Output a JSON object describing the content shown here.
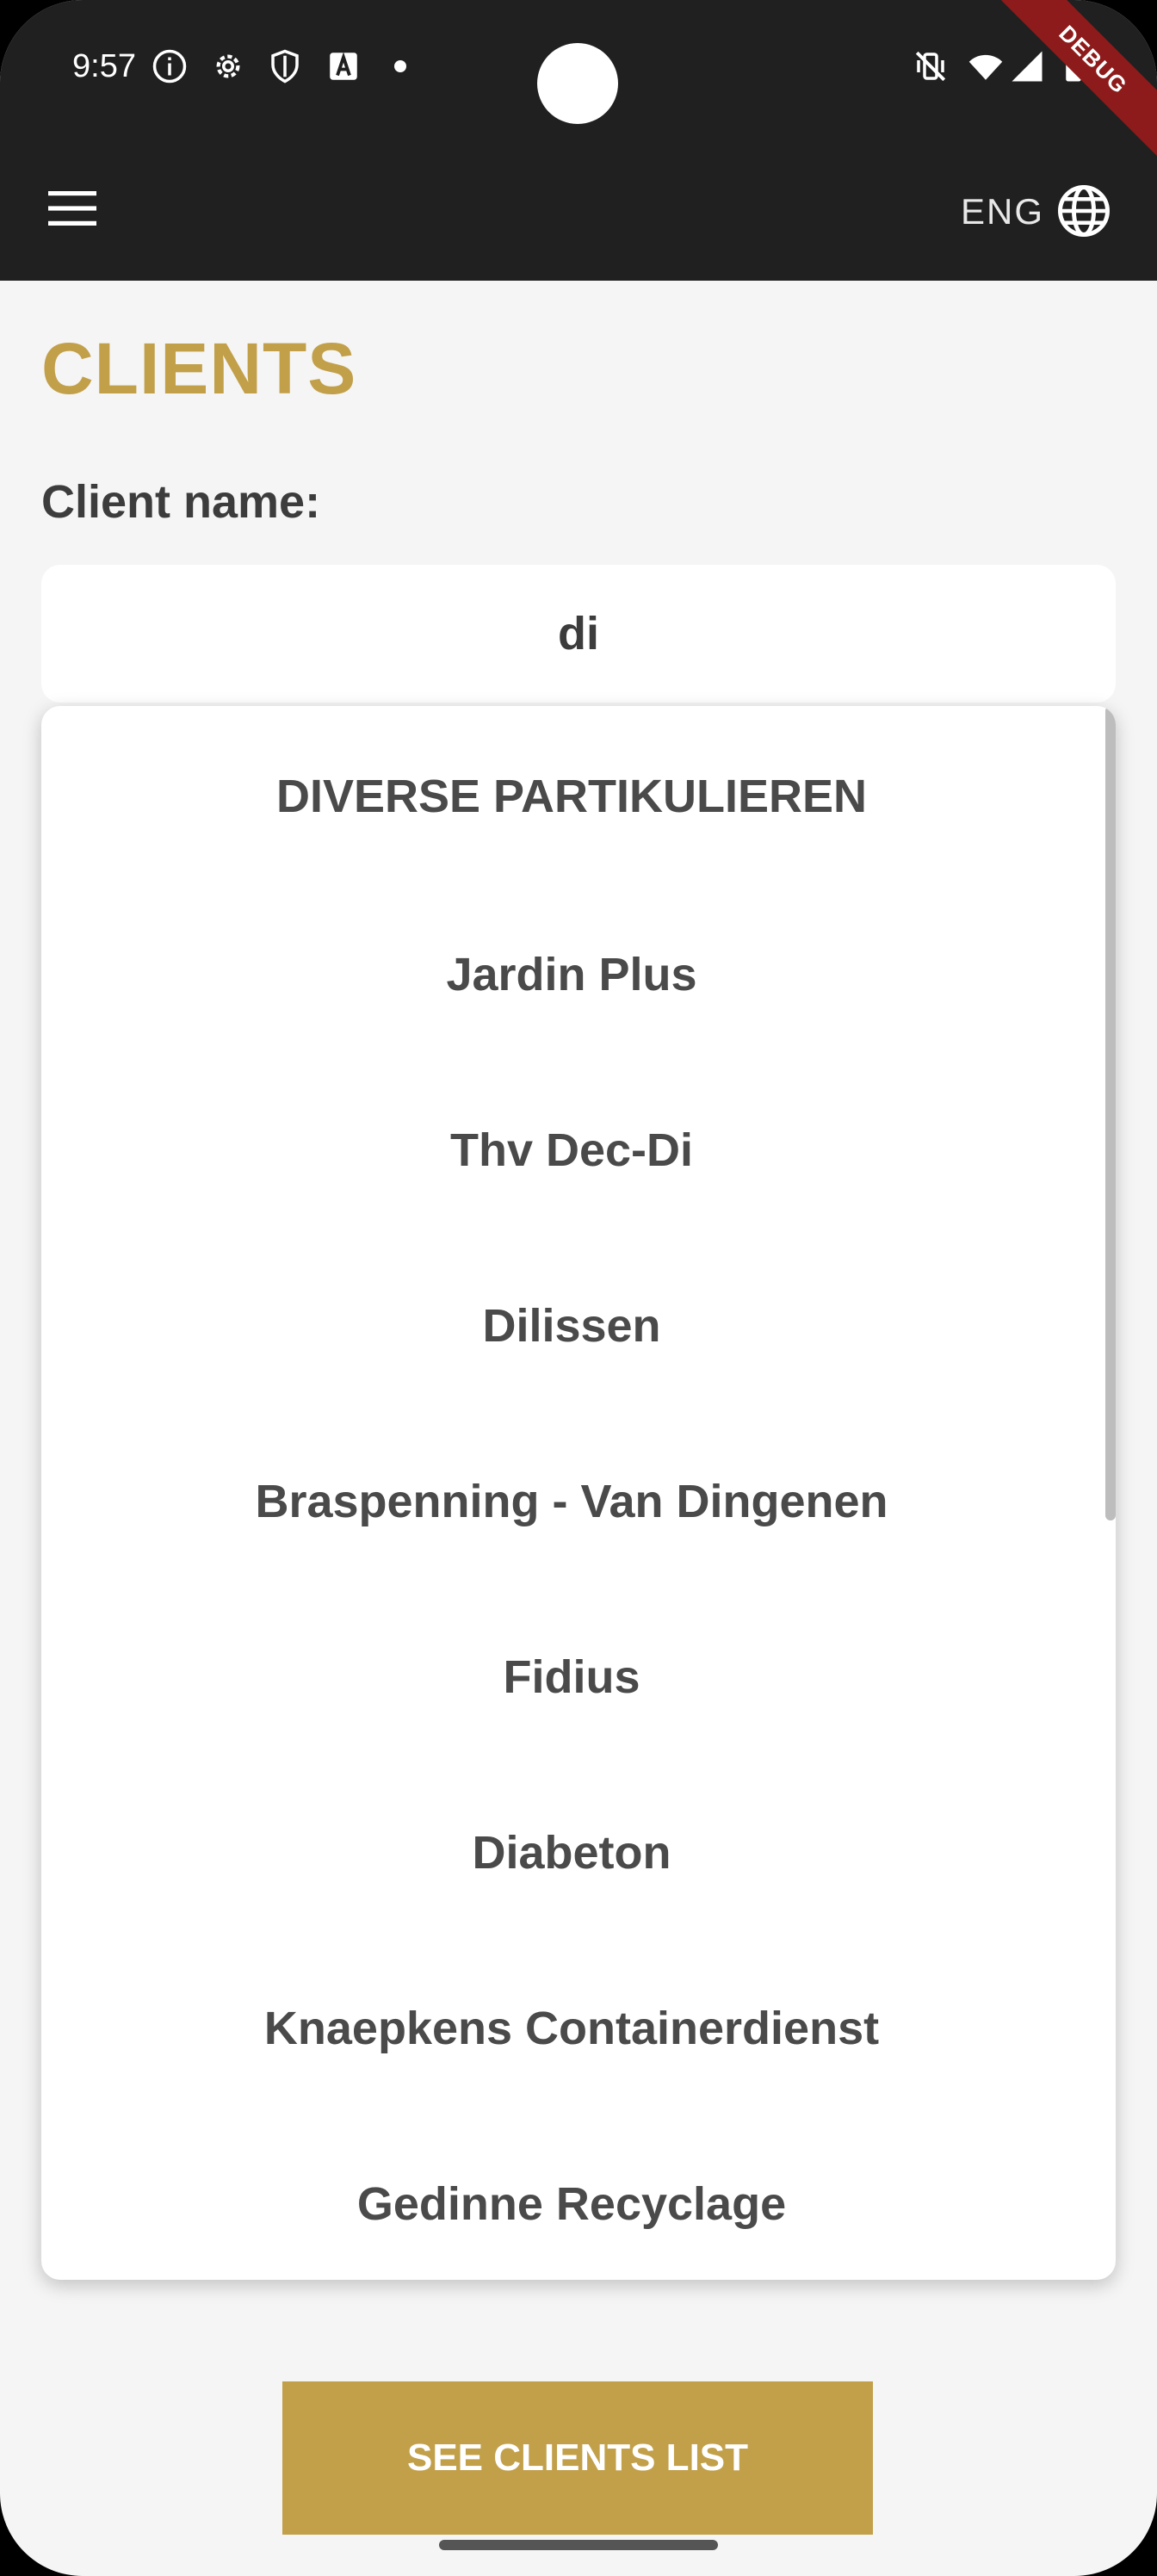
{
  "status_bar": {
    "time": "9:57"
  },
  "debug_banner": "DEBUG",
  "app_bar": {
    "language": "ENG"
  },
  "page": {
    "title": "CLIENTS",
    "field_label": "Client name:",
    "search_value": "di"
  },
  "dropdown": {
    "items": [
      "DIVERSE PARTIKULIEREN",
      "Jardin Plus",
      "Thv Dec-Di",
      "Dilissen",
      "Braspenning - Van Dingenen",
      "Fidius",
      "Diabeton",
      "Knaepkens Containerdienst",
      "Gedinne Recyclage"
    ]
  },
  "actions": {
    "see_clients_label": "SEE CLIENTS LIST"
  },
  "colors": {
    "accent": "#c2a04a",
    "app_bar": "#202020",
    "background": "#f5f5f5",
    "text": "#3c3c3c"
  }
}
